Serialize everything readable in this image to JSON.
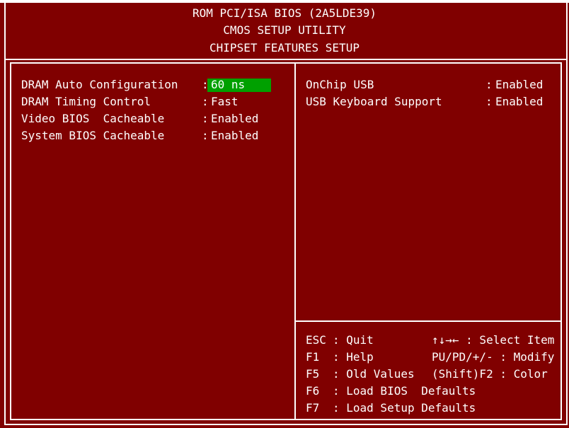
{
  "header": {
    "line1": "ROM PCI/ISA BIOS (2A5LDE39)",
    "line2": "CMOS SETUP UTILITY",
    "line3": "CHIPSET FEATURES SETUP"
  },
  "left_settings": [
    {
      "label": "DRAM Auto Configuration",
      "sep": ":",
      "value": "60 ns",
      "selected": true
    },
    {
      "label": "DRAM Timing Control",
      "sep": ":",
      "value": "Fast",
      "selected": false
    },
    {
      "label": "Video BIOS  Cacheable",
      "sep": ":",
      "value": "Enabled",
      "selected": false
    },
    {
      "label": "System BIOS Cacheable",
      "sep": ":",
      "value": "Enabled",
      "selected": false
    }
  ],
  "right_settings": [
    {
      "label": "OnChip USB",
      "sep": ":",
      "value": "Enabled"
    },
    {
      "label": "USB Keyboard Support",
      "sep": ":",
      "value": "Enabled"
    }
  ],
  "help": {
    "esc_key": "ESC",
    "esc_desc": ": Quit",
    "arrows_desc": "↑↓→← : Select Item",
    "f1_key": "F1",
    "f1_desc": ": Help",
    "modify_desc": "PU/PD/+/- : Modify",
    "f5_key": "F5",
    "f5_desc": ": Old Values",
    "color_desc": "(Shift)F2 : Color",
    "f6_key": "F6",
    "f6_desc": ": Load BIOS  Defaults",
    "f7_key": "F7",
    "f7_desc": ": Load Setup Defaults"
  },
  "colors": {
    "background": "#800000",
    "text": "#ffffff",
    "highlight": "#00a000",
    "border": "#ffffff"
  }
}
